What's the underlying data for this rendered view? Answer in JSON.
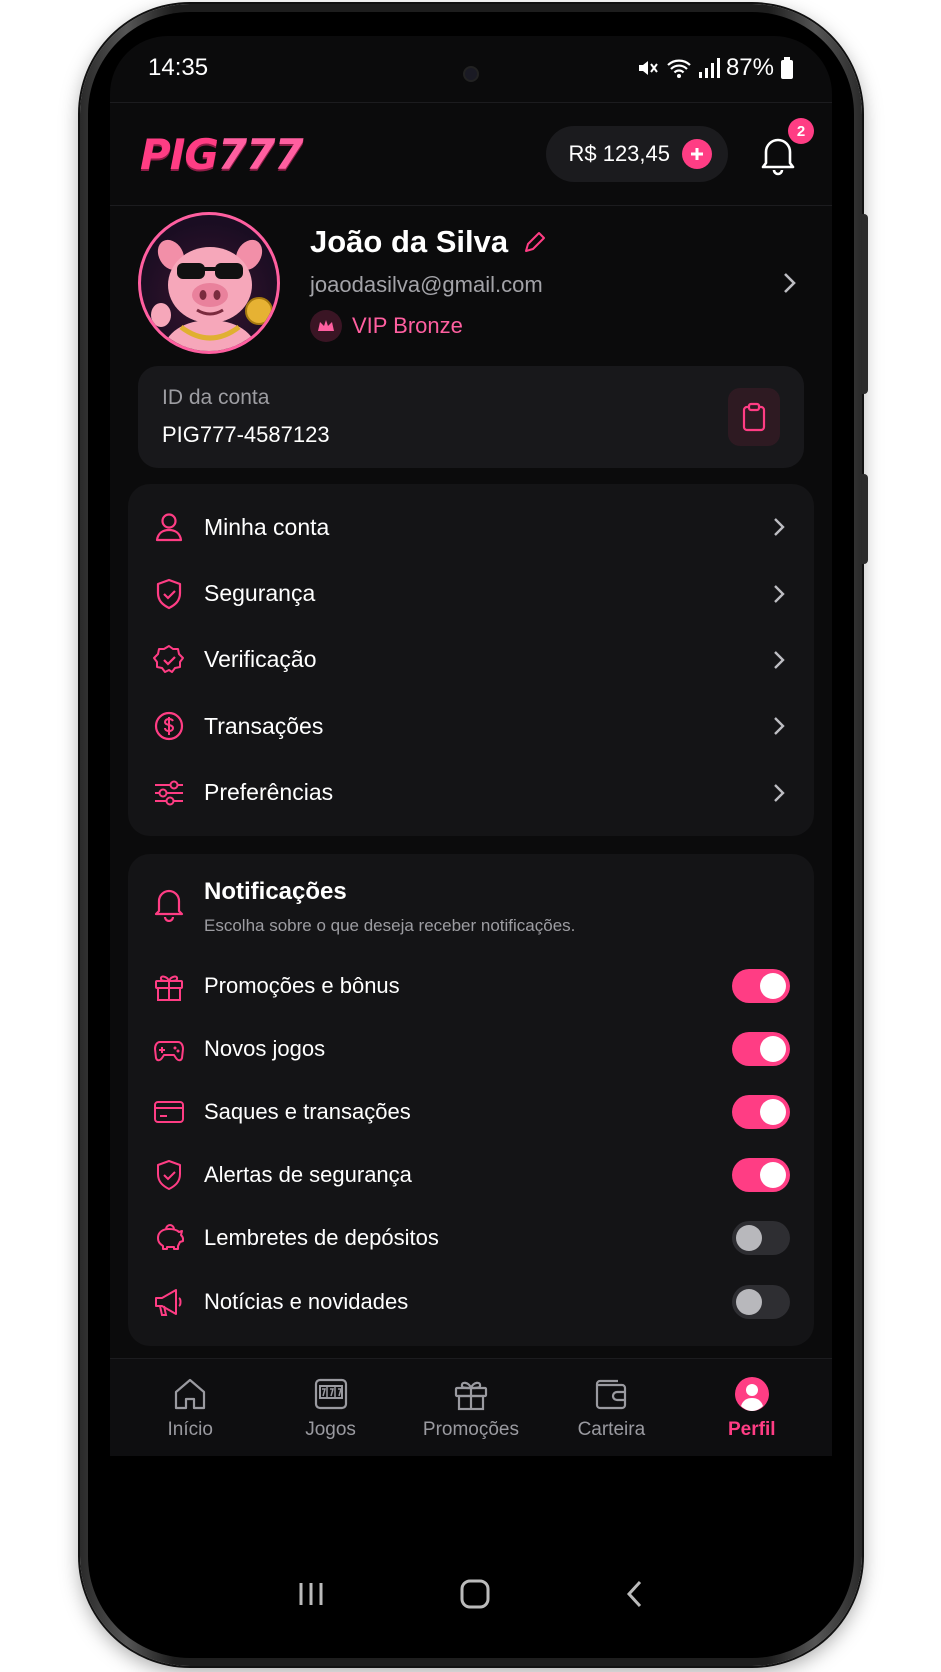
{
  "status_bar": {
    "time": "14:35",
    "battery": "87%"
  },
  "header": {
    "logo_text": "PIG",
    "logo_num": "777",
    "balance": "R$ 123,45",
    "notification_count": "2"
  },
  "profile": {
    "name": "João da Silva",
    "email": "joaodasilva@gmail.com",
    "vip_level": "VIP Bronze"
  },
  "account": {
    "label": "ID da conta",
    "id": "PIG777-4587123"
  },
  "menu": {
    "items": [
      {
        "label": "Minha conta",
        "icon": "user-icon"
      },
      {
        "label": "Segurança",
        "icon": "shield-icon"
      },
      {
        "label": "Verificação",
        "icon": "check-badge-icon"
      },
      {
        "label": "Transações",
        "icon": "dollar-icon"
      },
      {
        "label": "Preferências",
        "icon": "sliders-icon"
      }
    ]
  },
  "notifications": {
    "title": "Notificações",
    "subtitle": "Escolha sobre o que deseja receber notificações.",
    "items": [
      {
        "label": "Promoções e bônus",
        "icon": "gift-icon",
        "enabled": true
      },
      {
        "label": "Novos jogos",
        "icon": "gamepad-icon",
        "enabled": true
      },
      {
        "label": "Saques e transações",
        "icon": "card-icon",
        "enabled": true
      },
      {
        "label": "Alertas de segurança",
        "icon": "shield-icon",
        "enabled": true
      },
      {
        "label": "Lembretes de depósitos",
        "icon": "piggy-bank-icon",
        "enabled": false
      },
      {
        "label": "Notícias e novidades",
        "icon": "megaphone-icon",
        "enabled": false
      }
    ]
  },
  "bottom_nav": {
    "items": [
      {
        "label": "Início",
        "icon": "home-icon",
        "active": false
      },
      {
        "label": "Jogos",
        "icon": "slot-machine-icon",
        "active": false
      },
      {
        "label": "Promoções",
        "icon": "gift-icon",
        "active": false
      },
      {
        "label": "Carteira",
        "icon": "wallet-icon",
        "active": false
      },
      {
        "label": "Perfil",
        "icon": "profile-icon",
        "active": true
      }
    ]
  },
  "colors": {
    "accent": "#ff3d84",
    "background": "#0b0b0c",
    "card": "#141416",
    "muted_text": "#9d9da2"
  }
}
